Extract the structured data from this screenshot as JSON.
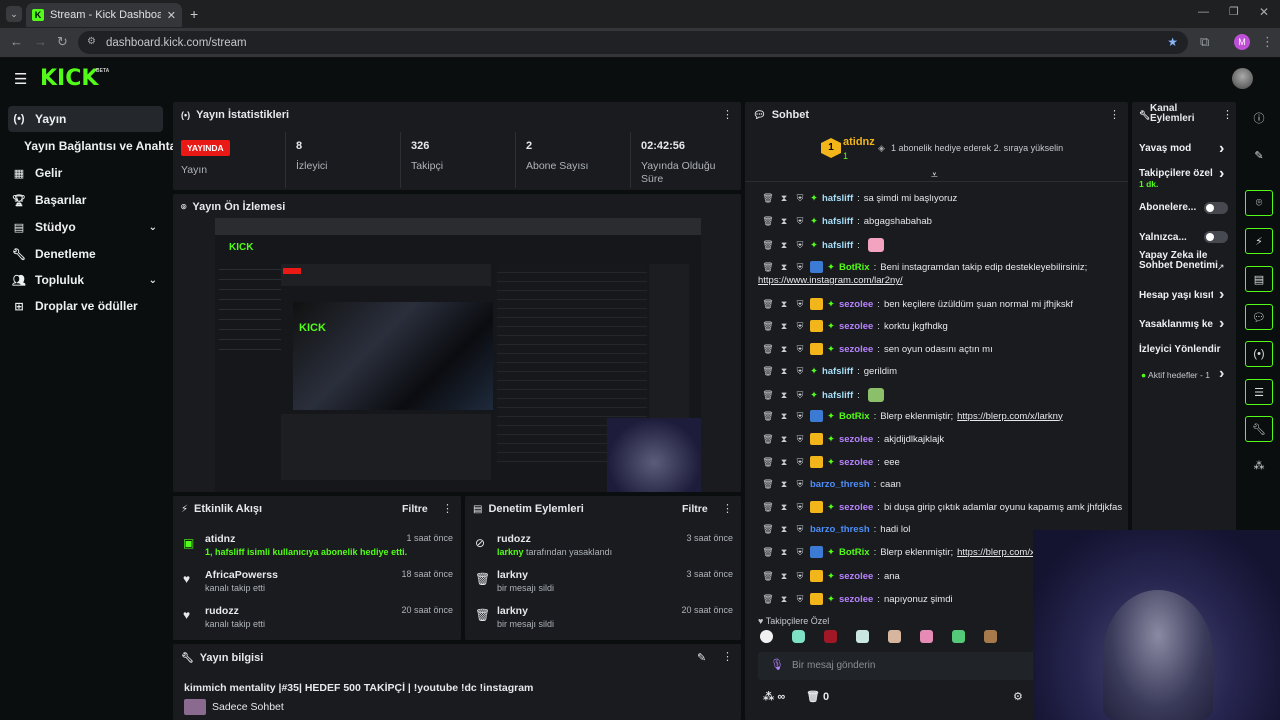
{
  "browser": {
    "tab_title": "Stream - Kick Dashboard",
    "url": "dashboard.kick.com/stream",
    "profile_initial": "M"
  },
  "brand": {
    "logo": "KICK",
    "beta": "BETA",
    "accent": "#53fc18"
  },
  "sidebar": {
    "items": [
      {
        "label": "Yayın",
        "icon": "broadcast-icon"
      },
      {
        "label": "Yayın Bağlantısı ve Anahtarı"
      },
      {
        "label": "Gelir",
        "icon": "revenue-icon"
      },
      {
        "label": "Başarılar",
        "icon": "trophy-icon"
      },
      {
        "label": "Stüdyo",
        "icon": "studio-icon"
      },
      {
        "label": "Denetleme",
        "icon": "wrench-icon"
      },
      {
        "label": "Topluluk",
        "icon": "community-icon"
      },
      {
        "label": "Droplar ve ödüller",
        "icon": "drops-icon"
      }
    ]
  },
  "stats": {
    "title": "Yayın İstatistikleri",
    "live": "YAYINDA",
    "status_label": "Yayın",
    "items": [
      {
        "value": "8",
        "label": "İzleyici"
      },
      {
        "value": "326",
        "label": "Takipçi"
      },
      {
        "value": "2",
        "label": "Abone Sayısı"
      },
      {
        "value": "02:42:56",
        "label": "Yayında Olduğu Süre"
      }
    ]
  },
  "preview": {
    "title": "Yayın Ön İzlemesi"
  },
  "activity": {
    "title": "Etkinlik Akışı",
    "filter": "Filtre",
    "events": [
      {
        "name": "atidnz",
        "desc": "1, hafsliff isimli kullanıcıya abonelik hediye etti.",
        "time": "1 saat önce"
      },
      {
        "name": "AfricaPowerss",
        "desc": "kanalı takip etti",
        "time": "18 saat önce"
      },
      {
        "name": "rudozz",
        "desc": "kanalı takip etti",
        "time": "20 saat önce"
      }
    ]
  },
  "modactions": {
    "title": "Denetim Eylemleri",
    "filter": "Filtre",
    "events": [
      {
        "name": "rudozz",
        "desc_user": "larkny",
        "desc": "tarafından yasaklandı",
        "time": "3 saat önce"
      },
      {
        "name": "larkny",
        "desc": "bir mesajı sildi",
        "time": "3 saat önce"
      },
      {
        "name": "larkny",
        "desc": "bir mesajı sildi",
        "time": "20 saat önce"
      }
    ]
  },
  "streaminfo": {
    "title": "Yayın bilgisi",
    "stream_title": "kimmich mentality |#35| HEDEF 500 TAKİPÇİ | !youtube !dc !instagram",
    "category": "Sadece Sohbet"
  },
  "chat": {
    "title": "Sohbet",
    "pinned_user": "atidnz",
    "pinned_count": "1",
    "pinned_text": "1 abonelik hediye ederek 2. sıraya yükselin",
    "messages": [
      {
        "user": "hafsliff",
        "color": "#a8ddf6",
        "text": "sa şimdi mi başlıyoruz"
      },
      {
        "user": "hafsliff",
        "color": "#a8ddf6",
        "text": "abgagshabahab"
      },
      {
        "user": "hafsliff",
        "color": "#a8ddf6",
        "text": "",
        "emote": true
      },
      {
        "user": "BotRix",
        "color": "#53fc18",
        "text": "Beni instagramdan takip edip destekleyebilirsiniz;",
        "link": "https://www.instagram.com/lar2ny/"
      },
      {
        "user": "sezolee",
        "color": "#b783ff",
        "text": "ben keçilere üzüldüm şuan normal mi jfhjkskf"
      },
      {
        "user": "sezolee",
        "color": "#b783ff",
        "text": "korktu jkgfhdkg"
      },
      {
        "user": "sezolee",
        "color": "#b783ff",
        "text": "sen oyun odasını açtın mı"
      },
      {
        "user": "hafsliff",
        "color": "#a8ddf6",
        "text": "gerildim"
      },
      {
        "user": "hafsliff",
        "color": "#a8ddf6",
        "text": "",
        "emote": true
      },
      {
        "user": "BotRix",
        "color": "#53fc18",
        "text": "Blerp eklenmiştir;",
        "link": "https://blerp.com/x/larkny"
      },
      {
        "user": "sezolee",
        "color": "#b783ff",
        "text": "akjdijdlkajklajk"
      },
      {
        "user": "sezolee",
        "color": "#b783ff",
        "text": "eee"
      },
      {
        "user": "barzo_thresh",
        "color": "#4e8ef7",
        "text": "caan"
      },
      {
        "user": "sezolee",
        "color": "#b783ff",
        "text": "bi duşa girip çıktık adamlar oyunu kapamış amk jhfdjkfas"
      },
      {
        "user": "barzo_thresh",
        "color": "#4e8ef7",
        "text": "hadi lol"
      },
      {
        "user": "BotRix",
        "color": "#53fc18",
        "text": "Blerp eklenmiştir;",
        "link": "https://blerp.com/x/lar"
      },
      {
        "user": "sezolee",
        "color": "#b783ff",
        "text": "ana"
      },
      {
        "user": "sezolee",
        "color": "#b783ff",
        "text": "napıyonuz şimdi"
      }
    ],
    "emotes_label": "Takipçilere Özel",
    "input_placeholder": "Bir mesaj gönderin",
    "points": "∞",
    "count": "0"
  },
  "channel": {
    "title": "Kanal Eylemleri",
    "items": [
      {
        "label": "Yavaş mod"
      },
      {
        "label": "Takipçilere özel",
        "sub": "1 dk."
      },
      {
        "label": "Abonelere..."
      },
      {
        "label": "Yalnızca..."
      },
      {
        "label": "Yapay Zeka ile Sohbet Denetimi"
      },
      {
        "label": "Hesap yaşı kısıtl"
      },
      {
        "label": "Yasaklanmış keli"
      },
      {
        "label": "İzleyici Yönlendir"
      },
      {
        "label": "Aktif hedefler - 1"
      }
    ]
  }
}
